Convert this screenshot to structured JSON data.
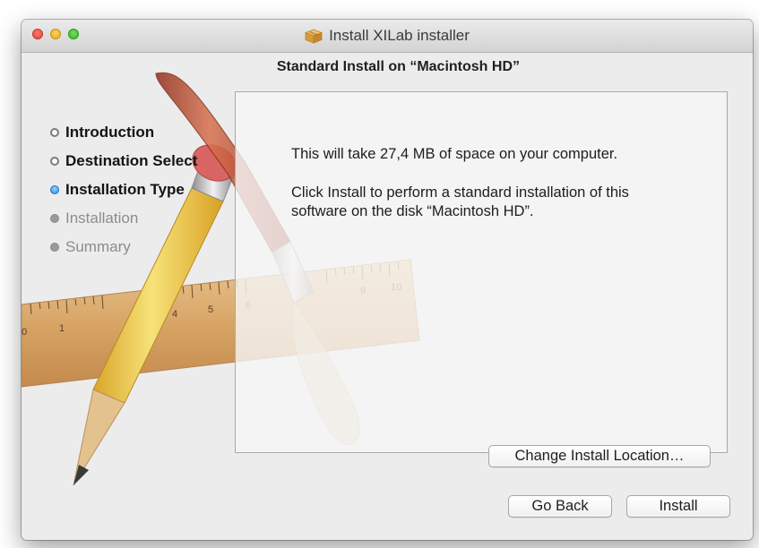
{
  "window": {
    "title": "Install XILab installer"
  },
  "header": {
    "heading": "Standard Install on “Macintosh HD”"
  },
  "sidebar": {
    "steps": [
      {
        "label": "Introduction",
        "state": "done"
      },
      {
        "label": "Destination Select",
        "state": "done"
      },
      {
        "label": "Installation Type",
        "state": "active"
      },
      {
        "label": "Installation",
        "state": "pending"
      },
      {
        "label": "Summary",
        "state": "pending"
      }
    ]
  },
  "main": {
    "space_text": "This will take 27,4 MB of space on your computer.",
    "info_text": "Click Install to perform a standard installation of this software on the disk “Macintosh HD”.",
    "change_location_label": "Change Install Location…"
  },
  "footer": {
    "back_label": "Go Back",
    "install_label": "Install"
  },
  "ruler": {
    "numbers": [
      "0",
      "1",
      "4",
      "5",
      "6",
      "9",
      "10"
    ]
  },
  "colors": {
    "active_step": "#2f8fe6",
    "close": "#e0443a",
    "minimize": "#e5a722",
    "zoom": "#35b52b"
  },
  "icons": {
    "title": "package-icon",
    "step_done": "hollow-dot",
    "step_active": "blue-dot",
    "step_pending": "gray-dot"
  }
}
